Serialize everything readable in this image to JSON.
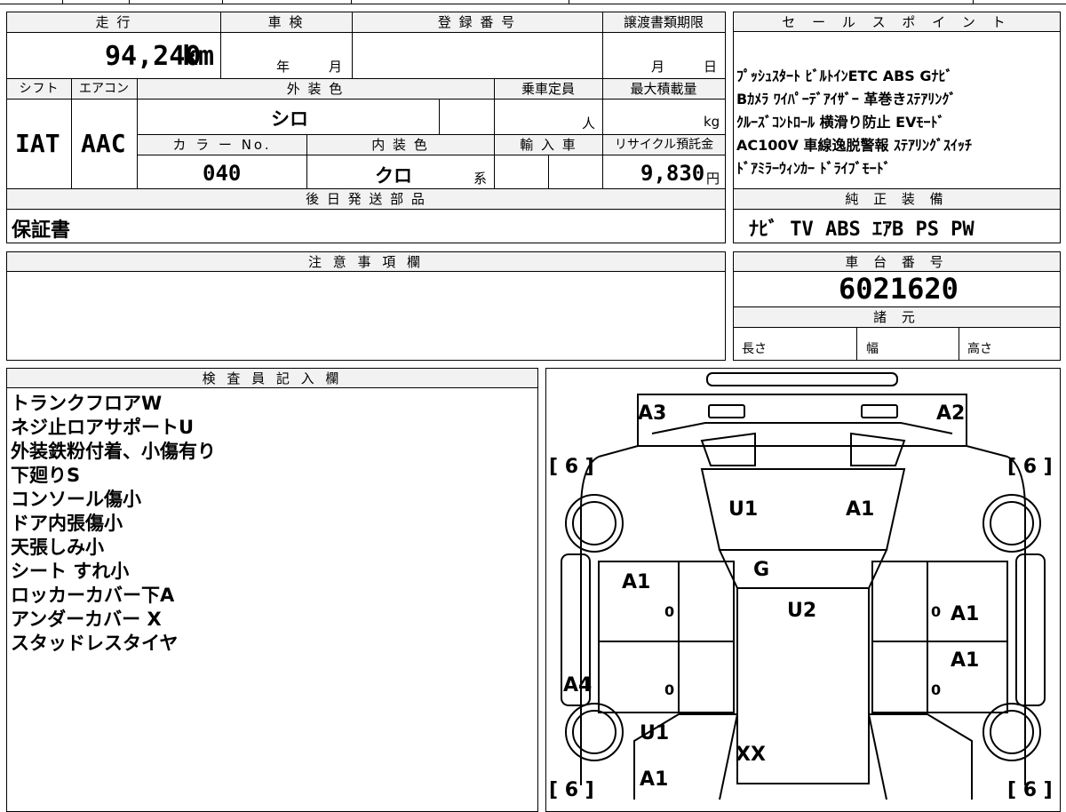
{
  "mileage": {
    "label": "走 行",
    "value": "94,240",
    "unit": "km"
  },
  "inspection": {
    "label": "車 検",
    "year_label": "年",
    "month_label": "月"
  },
  "registration": {
    "label": "登 録 番 号"
  },
  "transfer_deadline": {
    "label": "譲渡書類期限",
    "month_label": "月",
    "day_label": "日"
  },
  "shift": {
    "label": "シフト",
    "value": "IAT"
  },
  "aircon": {
    "label": "エアコン",
    "value": "AAC"
  },
  "exterior_color": {
    "label": "外 装 色",
    "value": "シロ"
  },
  "capacity": {
    "label": "乗車定員",
    "unit": "人"
  },
  "max_load": {
    "label": "最大積載量",
    "unit": "kg"
  },
  "color_no": {
    "label": "カ ラ ー No.",
    "value": "040"
  },
  "interior_color": {
    "label": "内 装 色",
    "value": "クロ",
    "suffix": "系"
  },
  "import": {
    "label": "輸 入 車"
  },
  "recycle": {
    "label": "リサイクル預託金",
    "value": "9,830",
    "unit": "円"
  },
  "later_parts": {
    "label": "後 日 発 送 部 品",
    "value": "保証書"
  },
  "notes": {
    "label": "注 意 事 項 欄"
  },
  "sales_points": {
    "label": "セ ー ル ス ポ イ ン ト",
    "lines": [
      "ﾌﾟｯｼｭｽﾀｰﾄ  ﾋﾞﾙﾄｲﾝETC  ABS  Gﾅﾋﾞ",
      "Bｶﾒﾗ  ﾜｲﾊﾟｰﾃﾞｱｲｻﾞｰ  革巻きｽﾃｱﾘﾝｸﾞ",
      "ｸﾙｰｽﾞｺﾝﾄﾛｰﾙ  横滑り防止  EVﾓｰﾄﾞ",
      "AC100V  車線逸脱警報  ｽﾃｱﾘﾝｸﾞｽｲｯﾁ",
      "ﾄﾞｱﾐﾗｰｳｨﾝｶｰ  ﾄﾞﾗｲﾌﾞﾓｰﾄﾞ"
    ]
  },
  "genuine_equipment": {
    "label": "純 正 装 備",
    "value": "ﾅﾋﾞ  TV  ABS  ｴｱB  PS  PW"
  },
  "chassis_number": {
    "label": "車 台 番 号",
    "value": "6021620"
  },
  "specs": {
    "label": "諸 元",
    "length_label": "長さ",
    "width_label": "幅",
    "height_label": "高さ"
  },
  "inspector": {
    "label": "検 査 員 記 入 欄",
    "lines": [
      "トランクフロアW",
      "ネジ止ロアサポートU",
      "外装鉄粉付着、小傷有り",
      "下廻りS",
      "コンソール傷小",
      "ドア内張傷小",
      "天張しみ小",
      "シート すれ小",
      "ロッカーカバー下A",
      "アンダーカバー X",
      "スタッドレスタイヤ"
    ]
  },
  "diagram": {
    "tire_front_left": "[ 6 ]",
    "tire_front_right": "[ 6 ]",
    "tire_rear_left": "[ 6 ]",
    "tire_rear_right": "[ 6 ]",
    "rear_left_corner": "A3",
    "rear_right_corner": "A2",
    "trunk_left": "U1",
    "trunk_right": "A1",
    "rear_glass": "G",
    "roof": "U2",
    "left_rear_door": "A1",
    "right_rear_door": "A1",
    "right_front_door": "A1",
    "left_rocker": "A4",
    "front_left_fender_u": "U1",
    "front_left_fender_a": "A1",
    "hood": "XX",
    "zero_marks": [
      "0",
      "0",
      "0",
      "0"
    ]
  }
}
